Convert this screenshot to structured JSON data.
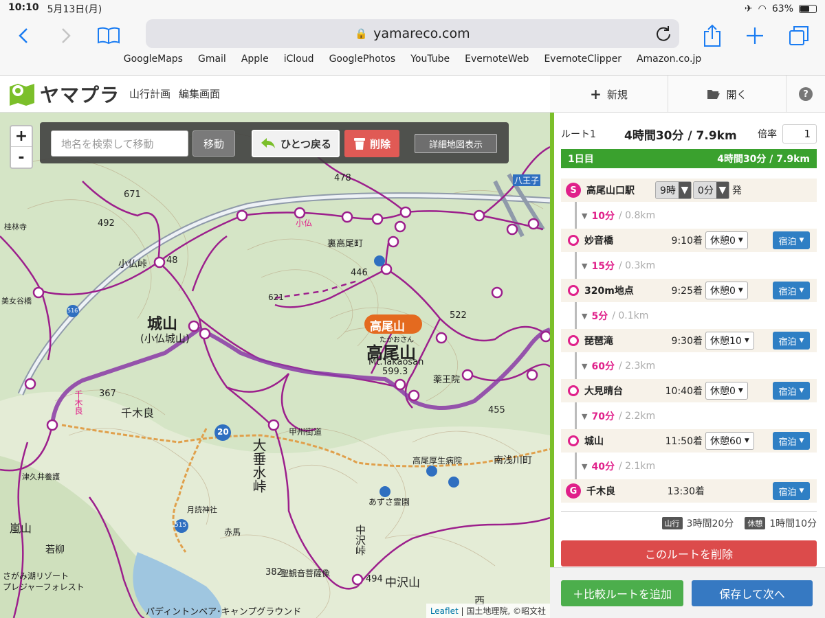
{
  "status": {
    "time": "10:10",
    "date": "5月13日(月)",
    "battery": "63%",
    "battery_level": 0.63
  },
  "browser": {
    "url": "yamareco.com",
    "bookmarks": [
      "GoogleMaps",
      "Gmail",
      "Apple",
      "iCloud",
      "GooglePhotos",
      "YouTube",
      "EvernoteWeb",
      "EvernoteClipper",
      "Amazon.co.jp"
    ]
  },
  "app": {
    "logo": "ヤマプラ",
    "menu": [
      "山行計画",
      "編集画面"
    ]
  },
  "side_tabs": {
    "new": "新規",
    "open": "開く",
    "help": "?"
  },
  "map": {
    "search_placeholder": "地名を検索して移動",
    "move": "移動",
    "undo": "ひとつ戻る",
    "delete": "削除",
    "detail": "詳細地図表示",
    "zoom_in": "+",
    "zoom_out": "-",
    "attribution": {
      "leaflet": "Leaflet",
      "rest": " | 国土地理院, ©昭文社"
    },
    "labels": {
      "takao_badge": "高尾山",
      "takao": "高尾山",
      "takao_kana": "たかおさん",
      "takao_en": "Mt.Takaosan",
      "takao_elev": "599.3",
      "shiroyama": "城山",
      "kobotoke_shiroyama": "(小仏城山)",
      "ourasan": "高尾山口",
      "senbokura": "千木良",
      "senbokura2": "千木良",
      "otarumi": "大垂水峠",
      "nakazawa": "中沢山",
      "nakazawa_toge": "中沢峠",
      "kobotoke_toge": "小仏峠",
      "kobotoke": "小仏",
      "ura_takao": "裏高尾町",
      "minami_asakawa": "南浅川町",
      "wakayanagi": "若柳",
      "sagamiko": "さがみ湖リゾート",
      "pleasure": "プレジャーフォレスト",
      "camp": "パディントンベア･キャンプグラウンド",
      "kudzu": "薬王院",
      "e478": "478",
      "e671": "671",
      "e492": "492",
      "e446": "446",
      "e522": "522",
      "e621": "621",
      "e367": "367",
      "e455": "455",
      "e382": "382",
      "e494": "494",
      "e548": "48",
      "route20": "20",
      "route515": "515",
      "route516": "516",
      "koshu": "甲州街道",
      "sei_kanon": "聖観音菩薩像",
      "tsukuinoko": "津久井養護",
      "arashiyama": "嵐山",
      "takao_kosei": "高尾厚生病院",
      "azusa": "あずさ霊園",
      "tsukuyomi": "月読神社",
      "akauma": "赤馬",
      "nishi": "西",
      "katsura": "桂林寺",
      "mikoku": "美女谷橋",
      "hachioji": "八王子"
    }
  },
  "route": {
    "name": "ルート1",
    "total": "4時間30分 / 7.9km",
    "rate_label": "倍率",
    "rate": "1",
    "day_label": "1日目",
    "day_total": "4時間30分 / 7.9km",
    "start": {
      "badge": "S",
      "name": "高尾山口駅",
      "hour": "9時",
      "minute": "0分",
      "suffix": "発"
    },
    "points": [
      {
        "name": "妙音橋",
        "time": "9:10着",
        "rest": "休憩0"
      },
      {
        "name": "320m地点",
        "time": "9:25着",
        "rest": "休憩0"
      },
      {
        "name": "琵琶滝",
        "time": "9:30着",
        "rest": "休憩10"
      },
      {
        "name": "大見晴台",
        "time": "10:40着",
        "rest": "休憩0"
      },
      {
        "name": "城山",
        "time": "11:50着",
        "rest": "休憩60"
      }
    ],
    "goal": {
      "badge": "G",
      "name": "千木良",
      "time": "13:30着"
    },
    "segments": [
      {
        "dur": "10分",
        "dist": "/ 0.8km"
      },
      {
        "dur": "15分",
        "dist": "/ 0.3km"
      },
      {
        "dur": "5分",
        "dist": "/ 0.1km"
      },
      {
        "dur": "60分",
        "dist": "/ 2.3km"
      },
      {
        "dur": "70分",
        "dist": "/ 2.2km"
      },
      {
        "dur": "40分",
        "dist": "/ 2.1km"
      }
    ],
    "stay": "宿泊",
    "summary": {
      "hike_tag": "山行",
      "hike": "3時間20分",
      "rest_tag": "休憩",
      "rest": "1時間10分"
    },
    "delete_route": "このルートを削除",
    "add_compare": "＋比較ルートを追加",
    "save_next": "保存して次へ"
  },
  "colors": {
    "route": "#9c1f8c",
    "planned": "#8a3aa6",
    "accent": "#e0208a",
    "green": "#3aa12e",
    "blue": "#3679c2",
    "red": "#dc4b4b"
  }
}
